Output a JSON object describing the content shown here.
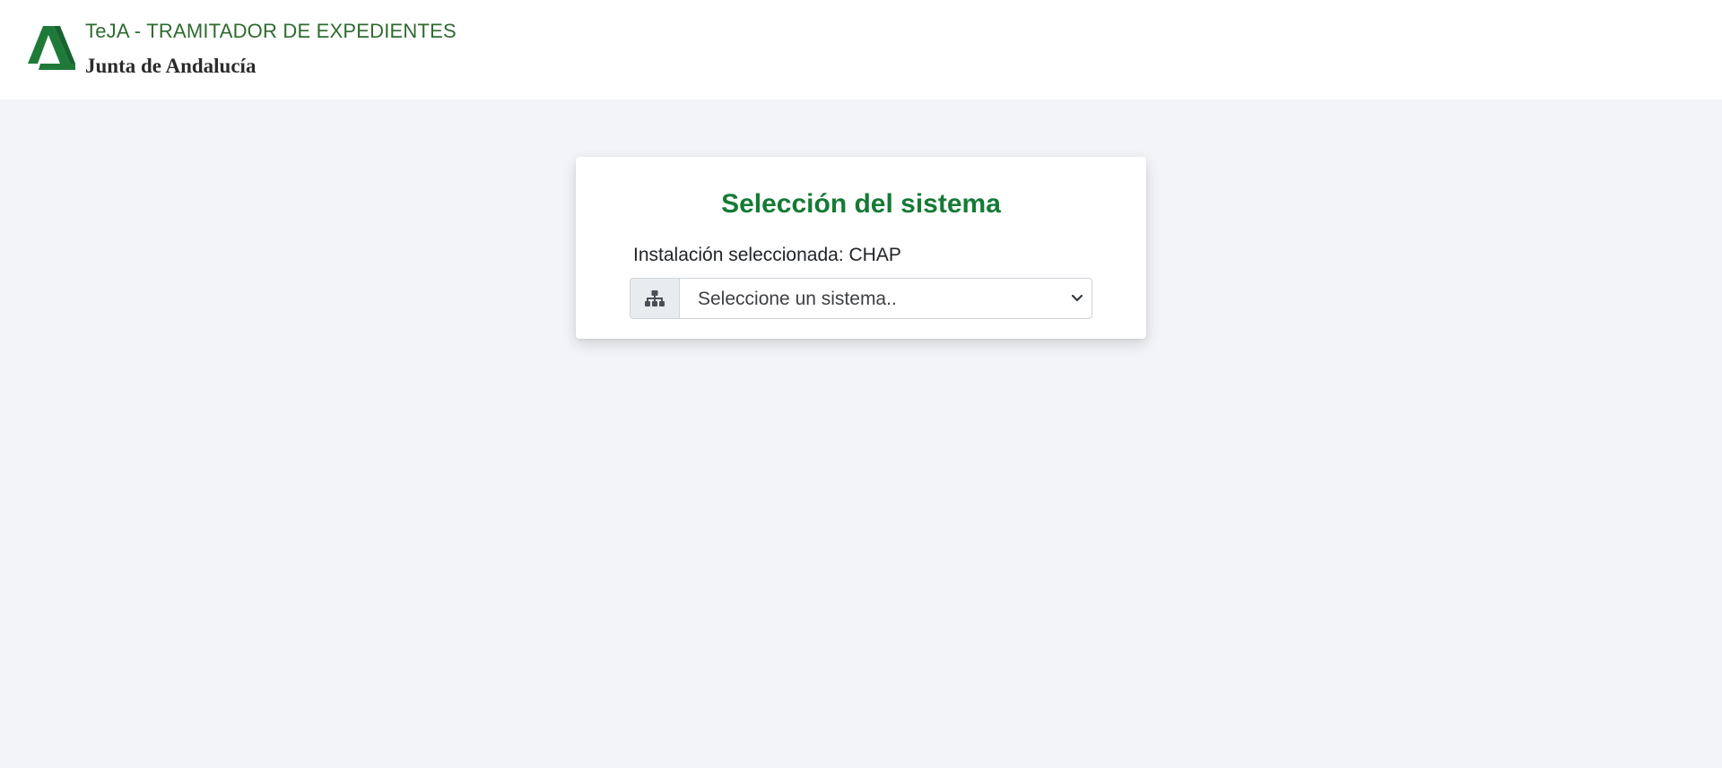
{
  "header": {
    "logo_icon": "junta-andalucia-logo-icon",
    "app_title": "TeJA - TRAMITADOR DE EXPEDIENTES",
    "org_name": "Junta de Andalucía"
  },
  "card": {
    "title": "Selección del sistema",
    "installation_label": "Instalación seleccionada: CHAP",
    "system_select": {
      "icon": "sitemap-icon",
      "placeholder": "Seleccione un sistema..",
      "selected": "Seleccione un sistema.."
    }
  },
  "colors": {
    "page_background": "#f2f4f7",
    "brand_green": "#157a35",
    "header_text_green": "#2e6b2f",
    "logo_green": "#1f7a3a"
  }
}
